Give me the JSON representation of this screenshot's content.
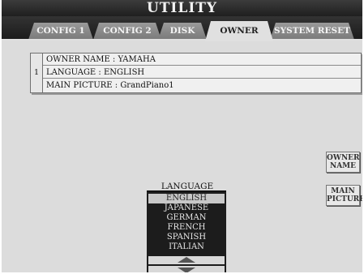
{
  "window": {
    "title": "UTILITY"
  },
  "tabs": [
    {
      "label": "CONFIG 1",
      "active": false
    },
    {
      "label": "CONFIG 2",
      "active": false
    },
    {
      "label": "DISK",
      "active": false
    },
    {
      "label": "OWNER",
      "active": true
    },
    {
      "label": "SYSTEM RESET",
      "active": false
    }
  ],
  "owner_table": {
    "index": "1",
    "rows": [
      {
        "label": "OWNER NAME : YAMAHA"
      },
      {
        "label": "LANGUAGE : ENGLISH"
      },
      {
        "label": "MAIN PICTURE : GrandPiano1"
      }
    ]
  },
  "side_buttons": {
    "owner_name": {
      "line1": "OWNER",
      "line2": "NAME"
    },
    "main_picture": {
      "line1": "MAIN",
      "line2": "PICTURE"
    }
  },
  "language": {
    "label": "LANGUAGE",
    "selected": "ENGLISH",
    "options": [
      "ENGLISH",
      "JAPANESE",
      "GERMAN",
      "FRENCH",
      "SPANISH",
      "ITALIAN"
    ]
  },
  "icons": {
    "scroll_up": "up-arrow-icon",
    "scroll_down": "down-arrow-icon"
  },
  "colors": {
    "title_bar": "#1f1f1f",
    "tab_inactive": "#8a8a8a",
    "tab_active": "#e0e0e0",
    "panel": "#dcdcdc",
    "list_background": "#1c1c1c",
    "list_selected": "#c8c8c8"
  }
}
